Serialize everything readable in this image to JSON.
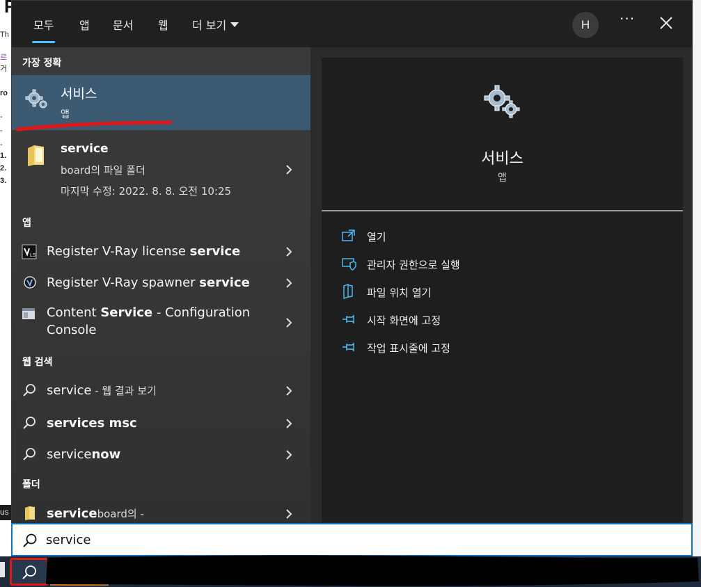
{
  "tabs": [
    {
      "label": "모두",
      "active": true
    },
    {
      "label": "앱",
      "active": false
    },
    {
      "label": "문서",
      "active": false
    },
    {
      "label": "웹",
      "active": false
    },
    {
      "label": "더 보기",
      "active": false
    }
  ],
  "account": {
    "initial": "H"
  },
  "more_label": "···",
  "sections": {
    "best_match": "가장 정확",
    "apps": "앱",
    "web": "웹 검색",
    "folders": "폴더"
  },
  "best_match": {
    "title": "서비스",
    "subtitle": "앱",
    "icon": "gears-icon"
  },
  "folder_result": {
    "title": "service",
    "location": "board의 파일 폴더",
    "modified": "마지막 수정: 2022. 8. 8. 오전 10:25",
    "icon": "folder-icon"
  },
  "apps": [
    {
      "pre": "Register V-Ray license ",
      "bold": "service",
      "post": "",
      "icon": "vray-license-icon"
    },
    {
      "pre": "Register V-Ray spawner ",
      "bold": "service",
      "post": "",
      "icon": "vray-spawner-icon"
    },
    {
      "pre": "Content ",
      "bold": "Service",
      "post": " - Configuration",
      "line2": "Console",
      "icon": "config-console-icon"
    }
  ],
  "web_results": [
    {
      "pre": "service",
      "bold": "",
      "suffix": " - 웹 결과 보기"
    },
    {
      "pre": "",
      "bold": "services msc",
      "suffix": ""
    },
    {
      "pre": "service",
      "bold": "now",
      "suffix": ""
    }
  ],
  "folder_partial": {
    "bold": "service",
    "rest": "board의 -"
  },
  "preview": {
    "title": "서비스",
    "subtitle": "앱",
    "icon": "gears-icon"
  },
  "actions": [
    {
      "label": "열기",
      "icon": "open-icon"
    },
    {
      "label": "관리자 권한으로 실행",
      "icon": "admin-shield-icon"
    },
    {
      "label": "파일 위치 열기",
      "icon": "file-location-icon"
    },
    {
      "label": "시작 화면에 고정",
      "icon": "pin-icon"
    },
    {
      "label": "작업 표시줄에 고정",
      "icon": "pin-icon"
    }
  ],
  "search": {
    "value": "service"
  },
  "background": {
    "heading": "F",
    "frag1": "Th",
    "frag2": "르",
    "frag3": "거",
    "frag4": "ro",
    "frag5": "-",
    "frag6": "-",
    "frag7": "-",
    "frag8": "1.",
    "frag9": "2.",
    "frag10": "3.",
    "strip": "us"
  },
  "colors": {
    "accent": "#4cc2ff",
    "selected_row": "#3d5a73",
    "search_border": "#0a74c9",
    "annotation_red": "#e01818"
  }
}
